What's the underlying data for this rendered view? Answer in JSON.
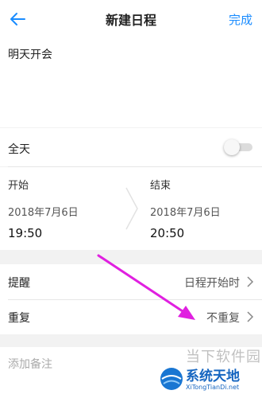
{
  "header": {
    "title": "新建日程",
    "done_label": "完成"
  },
  "note": {
    "text": "明天开会"
  },
  "all_day": {
    "label": "全天",
    "enabled": false
  },
  "time": {
    "start": {
      "label": "开始",
      "date": "2018年7月6日",
      "time": "19:50"
    },
    "end": {
      "label": "结束",
      "date": "2018年7月6日",
      "time": "20:50"
    }
  },
  "settings": [
    {
      "label": "提醒",
      "value": "日程开始时"
    },
    {
      "label": "重复",
      "value": "不重复"
    }
  ],
  "remarks": {
    "placeholder": "添加备注"
  },
  "watermark": {
    "top_text": "当下软件园",
    "brand": "系统天地",
    "url": "XiTongTianDi.net"
  },
  "colors": {
    "accent": "#1a8cff",
    "annotation": "#e020e0",
    "background": "#f2f2f2"
  }
}
